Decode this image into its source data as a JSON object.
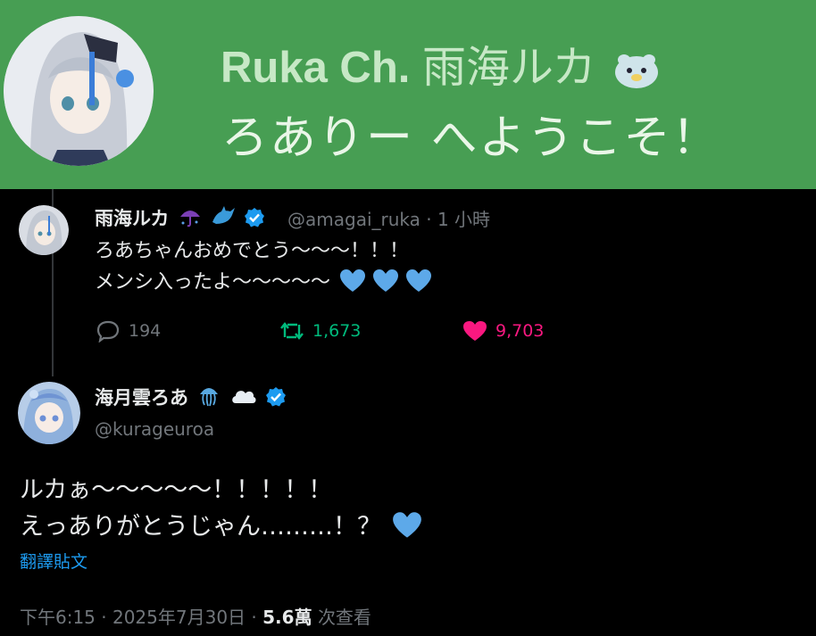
{
  "banner": {
    "title_latin": "Ruka Ch.",
    "title_jp": "雨海ルカ",
    "subtitle": "ろありー へようこそ！"
  },
  "reply_tweet": {
    "name": "雨海ルカ",
    "handle": "@amagai_ruka",
    "separator": "·",
    "time": "1 小時",
    "line1": "ろあちゃんおめでとう〜〜〜！！！",
    "line2": "メンシ入ったよ〜〜〜〜〜",
    "replies": "194",
    "retweets": "1,673",
    "likes": "9,703"
  },
  "main_tweet": {
    "name": "海月雲ろあ",
    "handle": "@kurageuroa",
    "line1": "ルカぁ〜〜〜〜〜！！！！！",
    "line2": "えっありがとうじゃん………！？",
    "translate": "翻譯貼文",
    "time_date": "下午6:15 · 2025年7月30日 ·",
    "views": "5.6萬",
    "views_label": "次查看"
  },
  "colors": {
    "banner_bg": "#479e53",
    "accent_blue": "#1d9bf0",
    "retweet_green": "#00ba7c",
    "like_pink": "#f91880",
    "muted": "#71767b"
  },
  "icons": [
    "verified-badge-icon",
    "reply-icon",
    "retweet-icon",
    "like-icon",
    "blue-heart-icon",
    "umbrella-emoji-icon",
    "dolphin-emoji-icon",
    "jellyfish-emoji-icon",
    "cloud-emoji-icon",
    "seal-emoji-icon"
  ]
}
